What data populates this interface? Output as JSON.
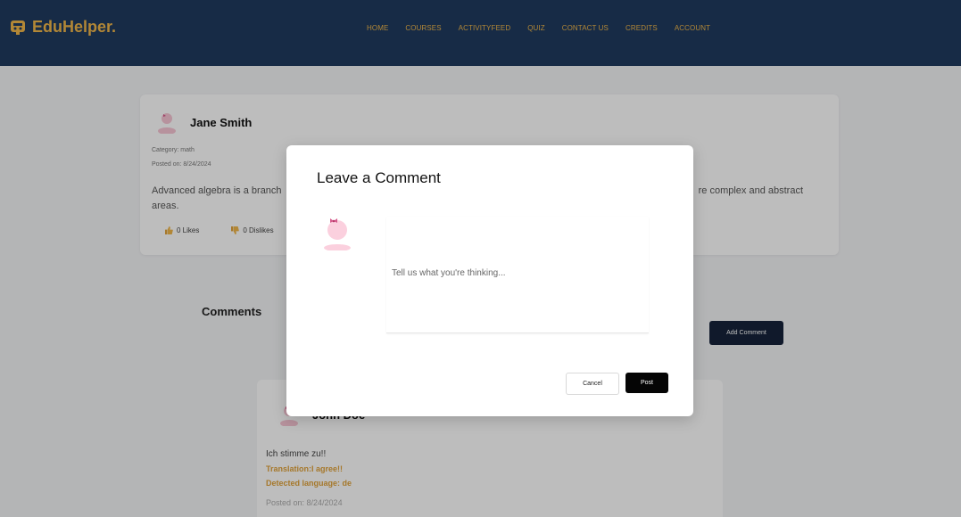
{
  "brand": {
    "name": "EduHelper.",
    "color": "#f0b64a",
    "header_bg": "#1f3a5f",
    "icon": "graduation-cap-icon"
  },
  "nav": {
    "items": [
      {
        "label": "HOME"
      },
      {
        "label": "COURSES"
      },
      {
        "label": "ACTIVITYFEED"
      },
      {
        "label": "QUIZ"
      },
      {
        "label": "CONTACT US"
      },
      {
        "label": "CREDITS"
      },
      {
        "label": "ACCOUNT"
      }
    ]
  },
  "post": {
    "author": "Jane Smith",
    "category": "Category: math",
    "posted_on": "Posted on: 8/24/2024",
    "body_start": "Advanced algebra is a branch",
    "body_end": "re complex and abstract",
    "body_line2": "areas.",
    "likes": "0 Likes",
    "dislikes": "0 Dislikes"
  },
  "comments": {
    "title": "Comments",
    "add_button": "Add Comment",
    "items": [
      {
        "author": "John Doe",
        "text": "Ich stimme zu!!",
        "translation": "Translation:I agree!!",
        "detected": "Detected language: de",
        "posted_on": "Posted on: 8/24/2024"
      }
    ]
  },
  "modal": {
    "title": "Leave a Comment",
    "placeholder": "Tell us what you're thinking...",
    "cancel": "Cancel",
    "post": "Post"
  }
}
